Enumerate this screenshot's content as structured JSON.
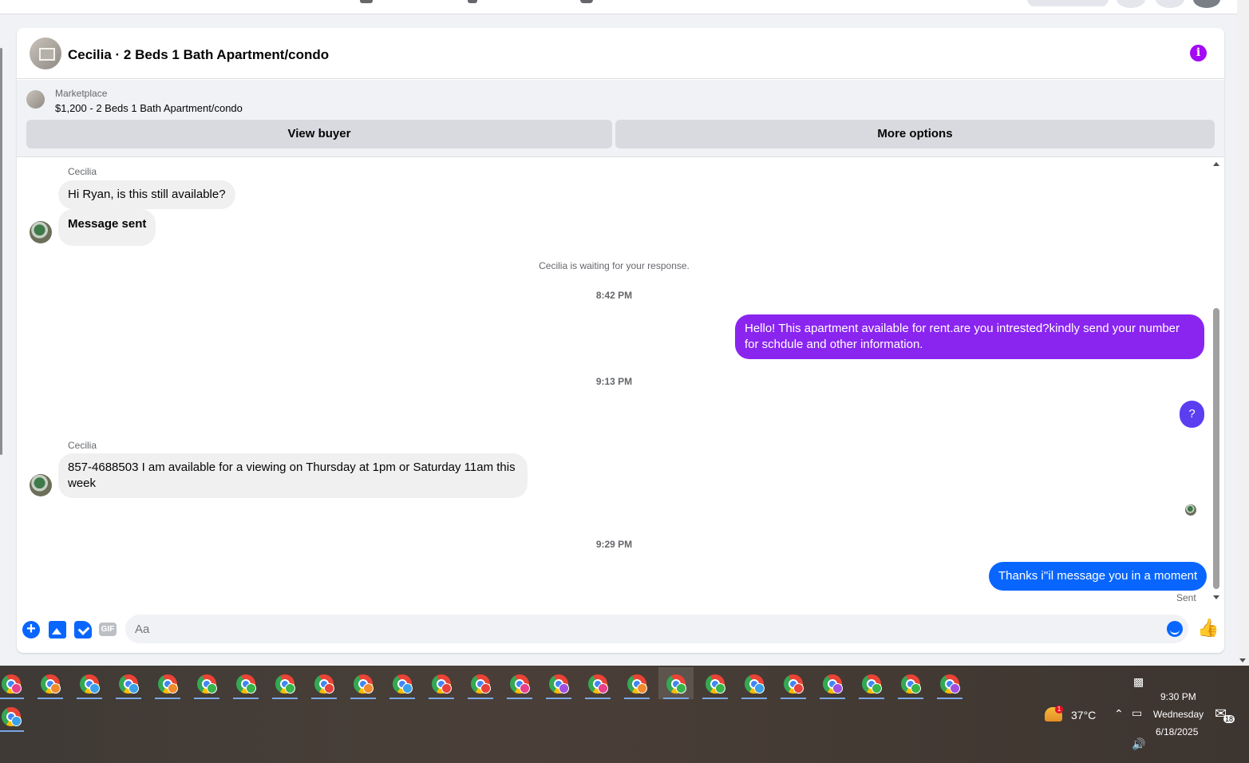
{
  "header": {
    "title": "Cecilia · 2 Beds 1 Bath Apartment/condo"
  },
  "marketplace": {
    "label": "Marketplace",
    "listing": "$1,200 - 2 Beds 1 Bath Apartment/condo",
    "view_buyer": "View buyer",
    "more_options": "More options"
  },
  "thread": {
    "sender_name_1": "Cecilia",
    "msg1": "Hi Ryan, is this still available?",
    "msg2": "Message sent",
    "waiting": "Cecilia is waiting for your response.",
    "ts1": "8:42 PM",
    "out1": "Hello! This apartment available for rent.are you intrested?kindly send your number for schdule and other information.",
    "ts2": "9:13 PM",
    "out2": "?",
    "sender_name_2": "Cecilia",
    "msg3": "857-4688503 I am available for a viewing on Thursday at 1pm or Saturday 11am this week",
    "ts3": "9:29 PM",
    "out3": "Thanks i''il message you in a moment",
    "status": "Sent"
  },
  "composer": {
    "placeholder": "Aa",
    "gif_label": "GIF"
  },
  "colors": {
    "purple": "#8a25f0",
    "violet": "#5b3ef0",
    "blue": "#0866ff"
  },
  "taskbar": {
    "apps": [
      {
        "profile": "#e8408a"
      },
      {
        "profile": "#f08a2b"
      },
      {
        "profile": "#3aa0e8"
      },
      {
        "profile": "#3aa0e8"
      },
      {
        "profile": "#f08a2b"
      },
      {
        "profile": "#37b34a"
      },
      {
        "profile": "#37b34a"
      },
      {
        "profile": "#37b34a"
      },
      {
        "profile": "#e8403a"
      },
      {
        "profile": "#f08a2b"
      },
      {
        "profile": "#3aa0e8"
      },
      {
        "profile": "#e8403a"
      },
      {
        "profile": "#e8403a"
      },
      {
        "profile": "#e8408a"
      },
      {
        "profile": "#a050e0"
      },
      {
        "profile": "#e8408a"
      },
      {
        "profile": "#f08a2b"
      },
      {
        "profile": "#37b34a"
      },
      {
        "profile": "#37b34a"
      },
      {
        "profile": "#3aa0e8"
      },
      {
        "profile": "#e8403a"
      },
      {
        "profile": "#a050e0"
      },
      {
        "profile": "#37b34a"
      },
      {
        "profile": "#37b34a"
      },
      {
        "profile": "#a050e0"
      },
      {
        "profile": "#3aa0e8"
      }
    ],
    "weather": "37°C",
    "weather_badge": "1",
    "time": "9:30 PM",
    "day": "Wednesday",
    "date": "6/18/2025",
    "notifications": "18"
  }
}
